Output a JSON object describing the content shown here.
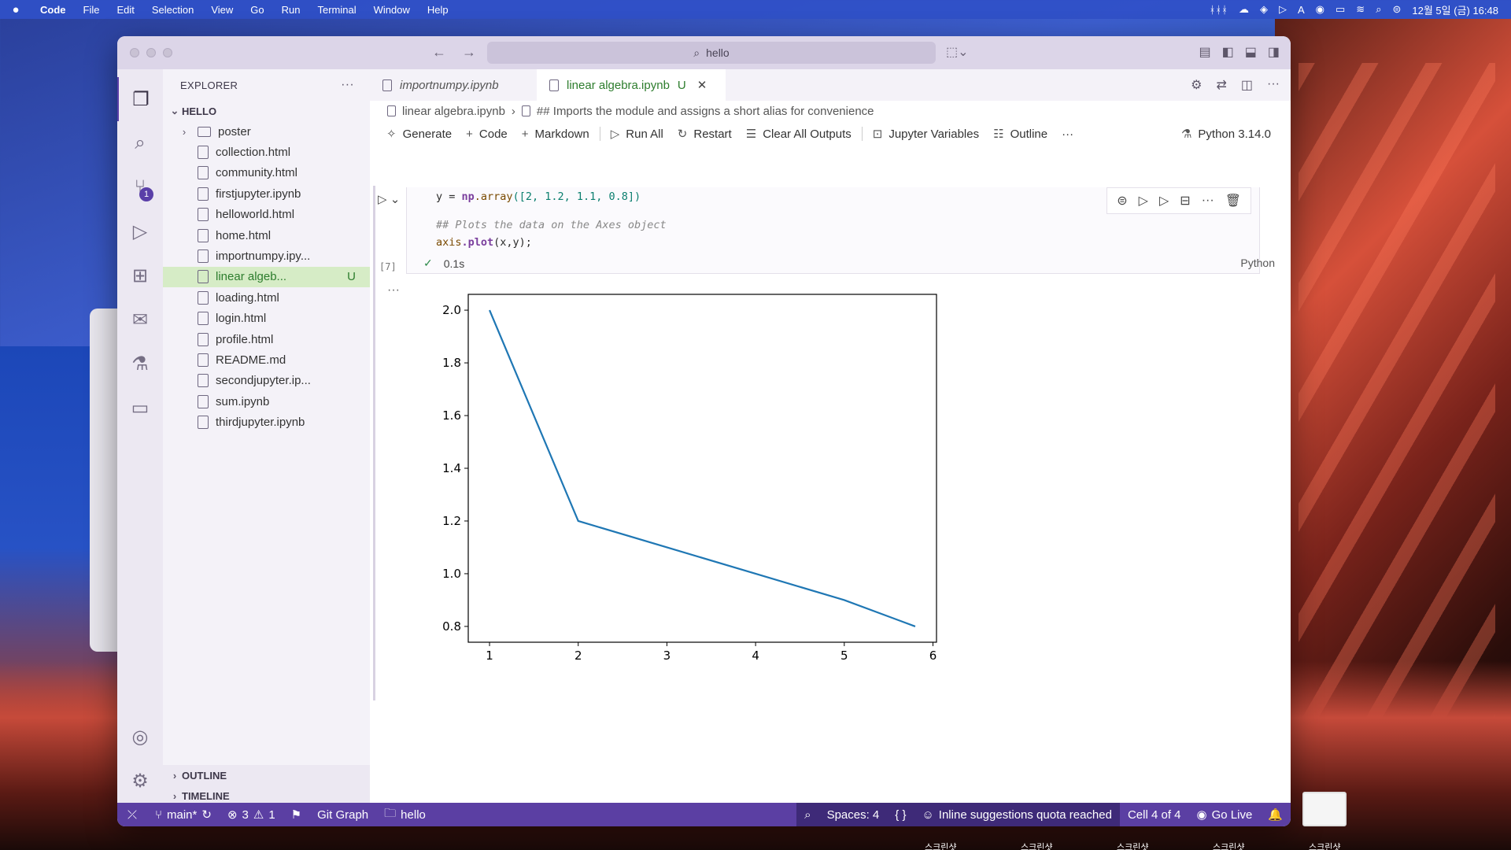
{
  "menubar": {
    "apple": "",
    "app": "Code",
    "items": [
      "File",
      "Edit",
      "Selection",
      "View",
      "Go",
      "Run",
      "Terminal",
      "Window",
      "Help"
    ],
    "clock": "12월 5일 (금) 16:48",
    "input_indicator": "A"
  },
  "titlebar": {
    "search": "hello"
  },
  "explorer": {
    "title": "EXPLORER",
    "more": "···",
    "folder": "HELLO",
    "items": [
      {
        "label": "poster",
        "kind": "folder"
      },
      {
        "label": "collection.html",
        "kind": "file"
      },
      {
        "label": "community.html",
        "kind": "file"
      },
      {
        "label": "firstjupyter.ipynb",
        "kind": "file"
      },
      {
        "label": "helloworld.html",
        "kind": "file"
      },
      {
        "label": "home.html",
        "kind": "file"
      },
      {
        "label": "importnumpy.ipy...",
        "kind": "file"
      },
      {
        "label": "linear algeb...",
        "kind": "file",
        "status": "U",
        "active": true
      },
      {
        "label": "loading.html",
        "kind": "file"
      },
      {
        "label": "login.html",
        "kind": "file"
      },
      {
        "label": "profile.html",
        "kind": "file"
      },
      {
        "label": "README.md",
        "kind": "file"
      },
      {
        "label": "secondjupyter.ip...",
        "kind": "file"
      },
      {
        "label": "sum.ipynb",
        "kind": "file"
      },
      {
        "label": "thirdjupyter.ipynb",
        "kind": "file"
      }
    ],
    "outline": "OUTLINE",
    "timeline": "TIMELINE"
  },
  "activity": {
    "scm_badge": "1"
  },
  "tabs": [
    {
      "label": "importnumpy.ipynb",
      "active": false
    },
    {
      "label": "linear algebra.ipynb",
      "active": true,
      "status": "U",
      "close": "✕"
    }
  ],
  "breadcrumb": {
    "file": "linear algebra.ipynb",
    "separator": "›",
    "section": "## Imports the module and assigns a short alias for convenience"
  },
  "toolbar": {
    "generate": "Generate",
    "code": "Code",
    "markdown": "Markdown",
    "run_all": "Run All",
    "restart": "Restart",
    "clear_outputs": "Clear All Outputs",
    "variables": "Jupyter Variables",
    "outline": "Outline",
    "more": "···",
    "kernel": "Python 3.14.0"
  },
  "cell": {
    "exec_count": "[7]",
    "line1_prefix": "y = ",
    "line1_mod": "np",
    "line1_fn": ".array",
    "line1_args": "([2, 1.2, 1.1, 0.8])",
    "comment": "## Plots the data on the Axes object",
    "line3_obj": "axis",
    "line3_fn": ".plot",
    "line3_args": "(x,y);",
    "duration": "0.1s",
    "language": "Python",
    "output_more": "···"
  },
  "chart_data": {
    "type": "line",
    "x": [
      1,
      2,
      3,
      4,
      5,
      5.8
    ],
    "series": [
      {
        "values": [
          2.0,
          1.2,
          1.1,
          1.0,
          0.9,
          0.8
        ],
        "color": "#1f77b4"
      }
    ],
    "xticks": [
      "1",
      "2",
      "3",
      "4",
      "5",
      "6"
    ],
    "yticks": [
      "0.8",
      "1.0",
      "1.2",
      "1.4",
      "1.6",
      "1.8",
      "2.0"
    ],
    "xlim": [
      0.76,
      6.04
    ],
    "ylim": [
      0.74,
      2.06
    ],
    "grid": false,
    "title": "",
    "xlabel": "",
    "ylabel": ""
  },
  "statusbar": {
    "branch": "main*",
    "errors": "3",
    "warnings": "1",
    "git_graph": "Git Graph",
    "folder": "hello",
    "spaces": "Spaces: 4",
    "braces": "{ }",
    "copilot": "Inline suggestions quota reached",
    "cell_pos": "Cell 4 of 4",
    "go_live": "Go Live"
  },
  "desktop": {
    "labels": [
      "스크린샷",
      "스크린샷",
      "스크린샷",
      "스크린샷",
      "스크린샷"
    ]
  }
}
